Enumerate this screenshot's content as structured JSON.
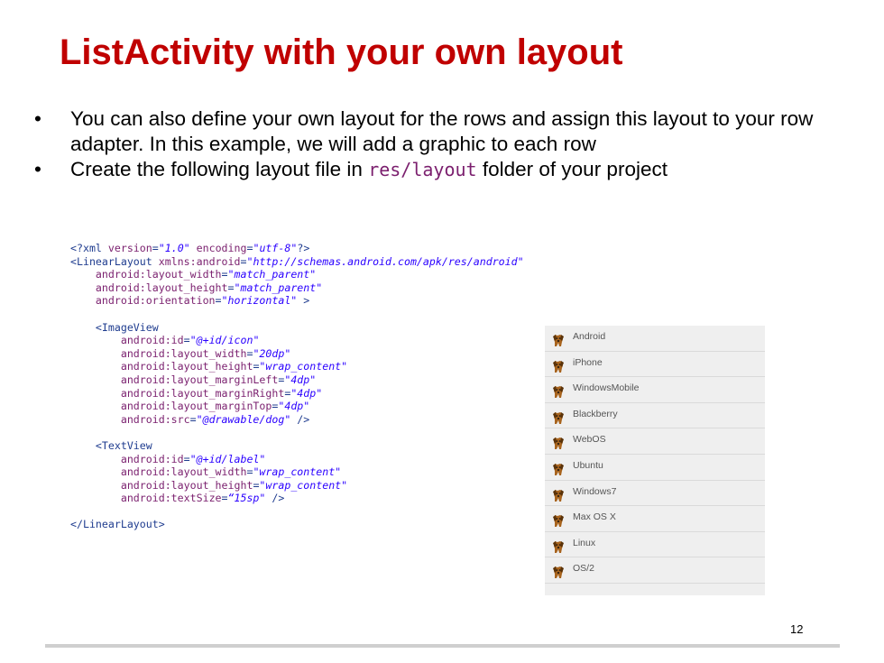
{
  "slide": {
    "title": "ListActivity with your own layout",
    "bullets": [
      {
        "text": "You can also define your own layout for the rows and assign this layout to your row adapter. In this example, we will add a graphic to each row"
      },
      {
        "before": "Create the following layout file in ",
        "code": "res/layout",
        "after": " folder of your project"
      }
    ],
    "bullet_char": "•",
    "code_lines": [
      [
        [
          "t",
          "<?xml "
        ],
        [
          "a",
          "version"
        ],
        [
          "t",
          "="
        ],
        [
          "v",
          "\"1.0\""
        ],
        [
          "t",
          " "
        ],
        [
          "a",
          "encoding"
        ],
        [
          "t",
          "="
        ],
        [
          "v",
          "\"utf-8\""
        ],
        [
          "t",
          "?>"
        ]
      ],
      [
        [
          "t",
          "<LinearLayout "
        ],
        [
          "a",
          "xmlns:android"
        ],
        [
          "t",
          "="
        ],
        [
          "v",
          "\"http://schemas.android.com/apk/res/android\""
        ]
      ],
      [
        [
          "t",
          "    "
        ],
        [
          "a",
          "android:layout_width"
        ],
        [
          "t",
          "="
        ],
        [
          "v",
          "\"match_parent\""
        ]
      ],
      [
        [
          "t",
          "    "
        ],
        [
          "a",
          "android:layout_height"
        ],
        [
          "t",
          "="
        ],
        [
          "v",
          "\"match_parent\""
        ]
      ],
      [
        [
          "t",
          "    "
        ],
        [
          "a",
          "android:orientation"
        ],
        [
          "t",
          "="
        ],
        [
          "v",
          "\"horizontal\""
        ],
        [
          "t",
          " >"
        ]
      ],
      [],
      [
        [
          "t",
          "    <ImageView"
        ]
      ],
      [
        [
          "t",
          "        "
        ],
        [
          "a",
          "android:id"
        ],
        [
          "t",
          "="
        ],
        [
          "v",
          "\"@+id/icon\""
        ]
      ],
      [
        [
          "t",
          "        "
        ],
        [
          "a",
          "android:layout_width"
        ],
        [
          "t",
          "="
        ],
        [
          "v",
          "\"20dp\""
        ]
      ],
      [
        [
          "t",
          "        "
        ],
        [
          "a",
          "android:layout_height"
        ],
        [
          "t",
          "="
        ],
        [
          "v",
          "\"wrap_content\""
        ]
      ],
      [
        [
          "t",
          "        "
        ],
        [
          "a",
          "android:layout_marginLeft"
        ],
        [
          "t",
          "="
        ],
        [
          "v",
          "\"4dp\""
        ]
      ],
      [
        [
          "t",
          "        "
        ],
        [
          "a",
          "android:layout_marginRight"
        ],
        [
          "t",
          "="
        ],
        [
          "v",
          "\"4dp\""
        ]
      ],
      [
        [
          "t",
          "        "
        ],
        [
          "a",
          "android:layout_marginTop"
        ],
        [
          "t",
          "="
        ],
        [
          "v",
          "\"4dp\""
        ]
      ],
      [
        [
          "t",
          "        "
        ],
        [
          "a",
          "android:src"
        ],
        [
          "t",
          "="
        ],
        [
          "v",
          "\"@drawable/dog\""
        ],
        [
          "t",
          " />"
        ]
      ],
      [],
      [
        [
          "t",
          "    <TextView"
        ]
      ],
      [
        [
          "t",
          "        "
        ],
        [
          "a",
          "android:id"
        ],
        [
          "t",
          "="
        ],
        [
          "v",
          "\"@+id/label\""
        ]
      ],
      [
        [
          "t",
          "        "
        ],
        [
          "a",
          "android:layout_width"
        ],
        [
          "t",
          "="
        ],
        [
          "v",
          "\"wrap_content\""
        ]
      ],
      [
        [
          "t",
          "        "
        ],
        [
          "a",
          "android:layout_height"
        ],
        [
          "t",
          "="
        ],
        [
          "v",
          "\"wrap_content\""
        ]
      ],
      [
        [
          "t",
          "        "
        ],
        [
          "a",
          "android:textSize"
        ],
        [
          "t",
          "="
        ],
        [
          "v",
          "“15sp\""
        ],
        [
          "t",
          " />"
        ]
      ],
      [],
      [
        [
          "t",
          "</LinearLayout>"
        ]
      ]
    ],
    "list_items": [
      "Android",
      "iPhone",
      "WindowsMobile",
      "Blackberry",
      "WebOS",
      "Ubuntu",
      "Windows7",
      "Max OS X",
      "Linux",
      "OS/2"
    ],
    "page_number": "12"
  }
}
